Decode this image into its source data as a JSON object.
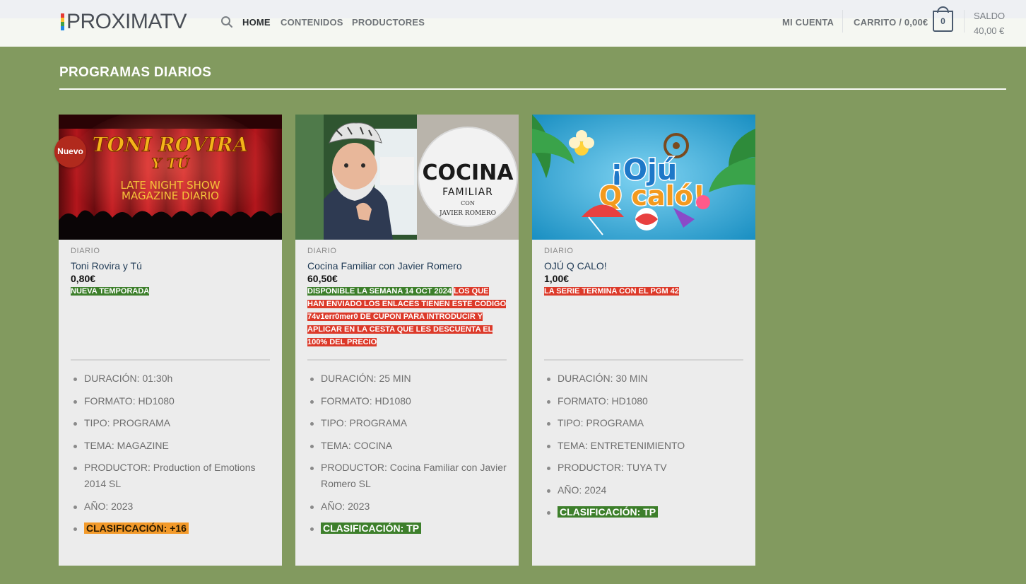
{
  "header": {
    "logo_text": "PROXIMATV",
    "nav": [
      {
        "label": "HOME",
        "active": true
      },
      {
        "label": "CONTENIDOS",
        "active": false
      },
      {
        "label": "PRODUCTORES",
        "active": false
      }
    ],
    "account_label": "MI CUENTA",
    "cart_label": "CARRITO / 0,00€",
    "cart_count": "0",
    "saldo_label": "SALDO",
    "saldo_value": "40,00 €"
  },
  "section": {
    "title": "PROGRAMAS DIARIOS"
  },
  "products": [
    {
      "badge": "Nuevo",
      "image_title": "TONI ROVIRA Y TÚ",
      "image_subtitle_1": "LATE NIGHT SHOW",
      "image_subtitle_2": "MAGAZINE DIARIO",
      "category": "DIARIO",
      "title": "Toni Rovira y Tú",
      "price": "0,80€",
      "notice_green": "NUEVA TEMPORADA",
      "notice_red": "",
      "specs": [
        "DURACIÓN: 01:30h",
        "FORMATO: HD1080",
        "TIPO: PROGRAMA",
        "TEMA: MAGAZINE",
        "PRODUCTOR: Production of Emotions 2014 SL",
        "AÑO: 2023"
      ],
      "rating": "CLASIFICACIÓN: +16",
      "rating_color": "#f39a2a"
    },
    {
      "image_title": "COCINA",
      "image_subtitle_1": "FAMILIAR",
      "image_subtitle_2": "CON",
      "image_subtitle_3": "JAVIER ROMERO",
      "category": "DIARIO",
      "title": "Cocina Familiar con Javier Romero",
      "price": "60,50€",
      "notice_green": "DISPONIBLE LA SEMANA 14 OCT 2024",
      "notice_red": "LOS QUE HAN ENVIADO LOS ENLACES TIENEN ESTE CODIGO 74v1err0mer0 DE CUPON PARA INTRODUCIR Y APLICAR EN LA CESTA QUE LES DESCUENTA EL 100% DEL PRECIO",
      "specs": [
        "DURACIÓN: 25 MIN",
        "FORMATO: HD1080",
        "TIPO: PROGRAMA",
        "TEMA: COCINA",
        "PRODUCTOR: Cocina Familiar con Javier Romero SL",
        "AÑO: 2023"
      ],
      "rating": "CLASIFICACIÓN: TP",
      "rating_color": "#3d7f2b"
    },
    {
      "image_title": "¡Ojú",
      "image_subtitle_1": "Q caló!",
      "category": "DIARIO",
      "title": "OJÚ Q CALO!",
      "price": "1,00€",
      "notice_green": "",
      "notice_red": "LA SERIE TERMINA CON EL PGM 42",
      "specs": [
        "DURACIÓN: 30 MIN",
        "FORMATO: HD1080",
        "TIPO: PROGRAMA",
        "TEMA: ENTRETENIMIENTO",
        "PRODUCTOR: TUYA TV",
        "AÑO: 2024"
      ],
      "rating": "CLASIFICACIÓN: TP",
      "rating_color": "#3d7f2b"
    }
  ]
}
